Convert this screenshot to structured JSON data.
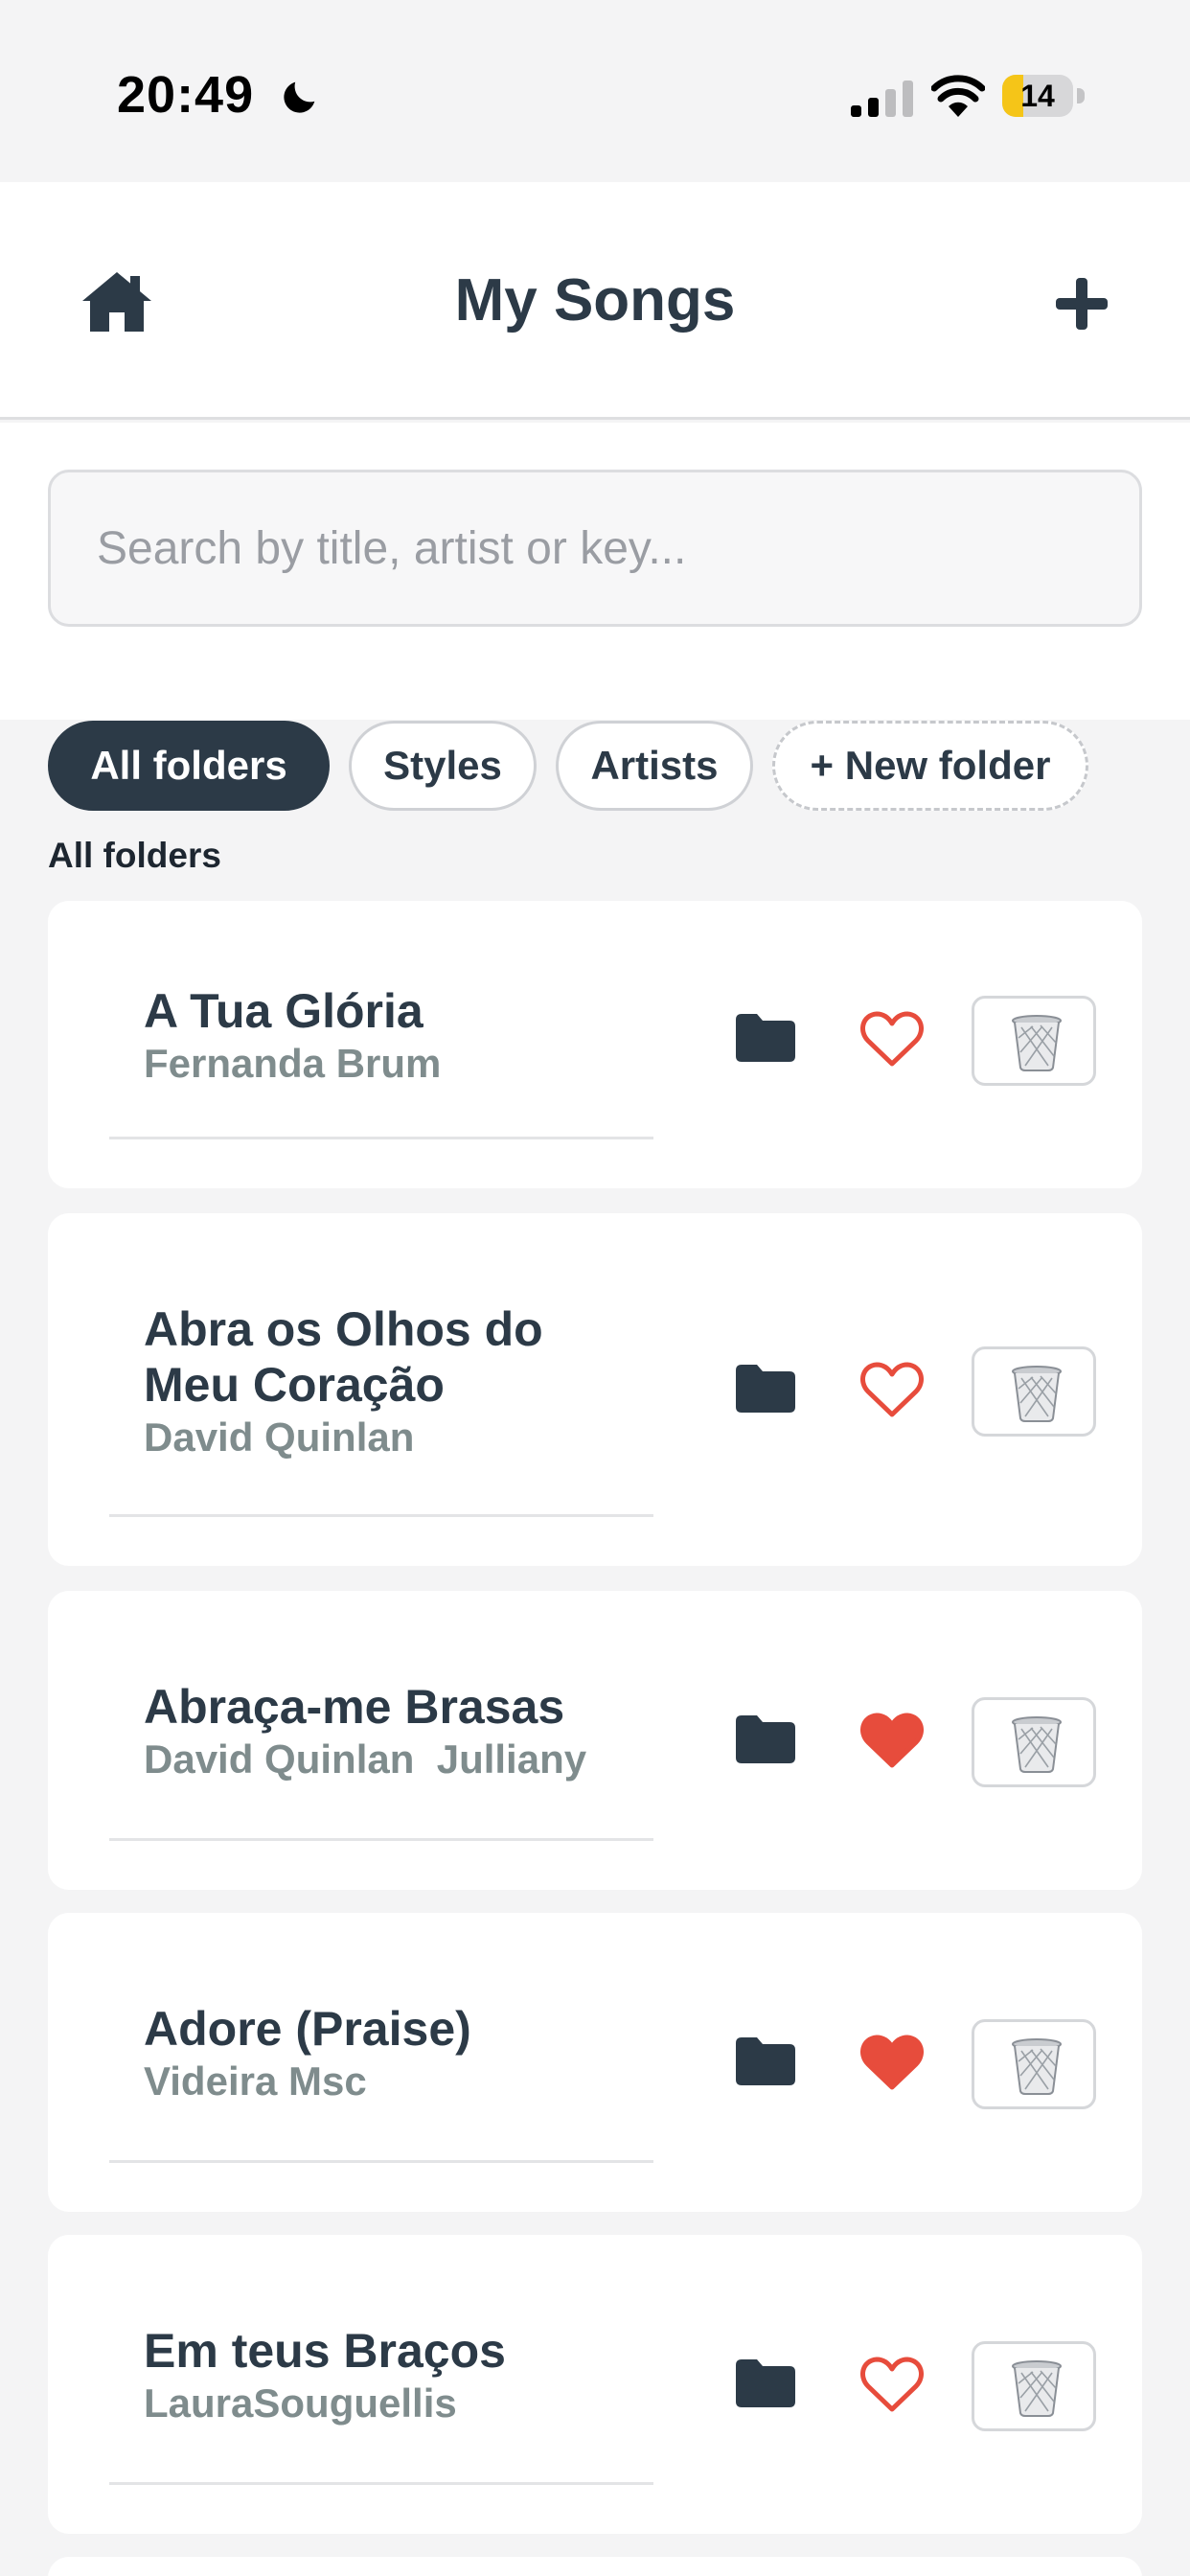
{
  "status_bar": {
    "time": "20:49",
    "battery": "14",
    "icons": [
      "moon-icon",
      "signal-icon",
      "wifi-icon",
      "battery-icon"
    ]
  },
  "header": {
    "title": "My Songs",
    "home_icon": "home-icon",
    "add_icon": "plus-icon"
  },
  "search": {
    "placeholder": "Search by title, artist or key..."
  },
  "folders": {
    "chips": [
      {
        "label": "All folders",
        "active": true
      },
      {
        "label": "Styles",
        "active": false
      },
      {
        "label": "Artists",
        "active": false
      },
      {
        "label": "+ New folder",
        "active": false
      }
    ],
    "current": "All folders"
  },
  "songs": [
    {
      "title": "A Tua Glória",
      "artist": "Fernanda Brum",
      "favorite": false
    },
    {
      "title": "Abra os Olhos do Meu Coração",
      "artist": "David Quinlan",
      "favorite": false
    },
    {
      "title": "Abraça-me Brasas",
      "artist": "David Quinlan  Julliany",
      "favorite": true
    },
    {
      "title": "Adore (Praise)",
      "artist": "Videira Msc",
      "favorite": true
    },
    {
      "title": "Em teus Braços",
      "artist": "LauraSouguellis",
      "favorite": false
    }
  ],
  "colors": {
    "primary": "#2c3a47",
    "heart": "#e74c3c",
    "artist_text": "#7f8c8d",
    "background": "#f4f4f5"
  }
}
